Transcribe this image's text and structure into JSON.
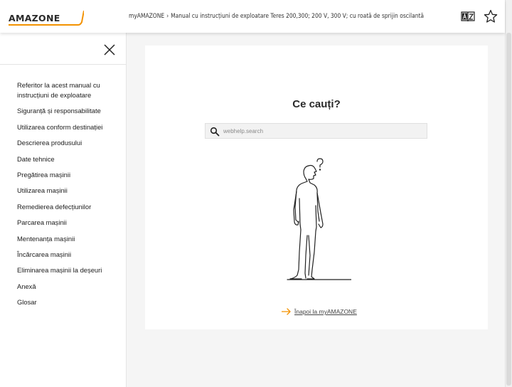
{
  "header": {
    "logo_text": "AMAZONE",
    "breadcrumb_root": "myAMAZONE",
    "breadcrumb_separator": "›",
    "breadcrumb_current": "Manual cu instrucțiuni de exploatare Teres 200,300; 200 V, 300 V; cu roată de sprijin oscilantă",
    "icons": [
      "glossary-az-icon",
      "star-icon"
    ]
  },
  "sidebar": {
    "items": [
      {
        "label": "Referitor la acest manual cu instrucțiuni de exploatare"
      },
      {
        "label": "Siguranță și responsabilitate"
      },
      {
        "label": "Utilizarea conform destinației"
      },
      {
        "label": "Descrierea produsului"
      },
      {
        "label": "Date tehnice"
      },
      {
        "label": "Pregătirea mașinii"
      },
      {
        "label": "Utilizarea mașinii"
      },
      {
        "label": "Remedierea defecțiunilor"
      },
      {
        "label": "Parcarea mașinii"
      },
      {
        "label": "Mentenanța mașinii"
      },
      {
        "label": "Încărcarea mașinii"
      },
      {
        "label": "Eliminarea mașinii la deșeuri"
      },
      {
        "label": "Anexă"
      },
      {
        "label": "Glosar"
      }
    ]
  },
  "main": {
    "title": "Ce cauți?",
    "search_placeholder": "webhelp.search",
    "back_link": "Înapoi la myAMAZONE"
  },
  "colors": {
    "accent": "#f39200",
    "text": "#222222",
    "background": "#f5f5f5"
  }
}
